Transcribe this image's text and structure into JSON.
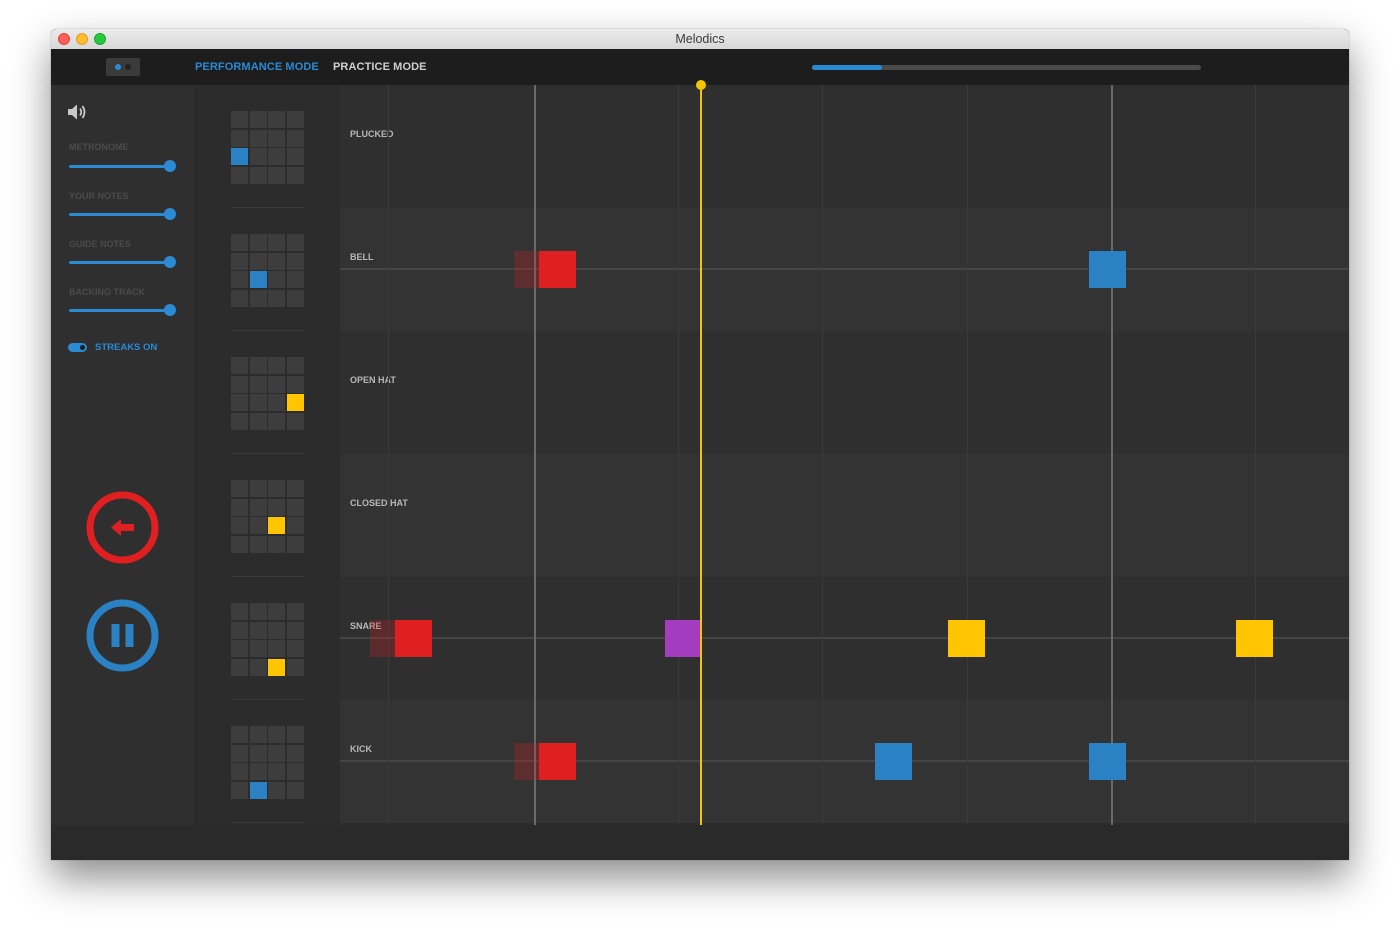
{
  "window": {
    "title": "Melodics"
  },
  "toolbar": {
    "performance_mode_label": "PERFORMANCE MODE",
    "practice_mode_label": "PRACTICE MODE",
    "progress_fraction": 0.18
  },
  "sidebar": {
    "sliders": [
      {
        "label": "METRONOME",
        "value": 1.0
      },
      {
        "label": "YOUR NOTES",
        "value": 1.0
      },
      {
        "label": "GUIDE NOTES",
        "value": 1.0
      },
      {
        "label": "BACKING TRACK",
        "value": 1.0
      }
    ],
    "streaks_label": "STREAKS ON",
    "streaks_on": true,
    "back_button_icon": "arrow-left-icon",
    "pause_button_icon": "pause-icon"
  },
  "colors": {
    "accent_blue": "#2a8ad4",
    "note_red": "#e02020",
    "note_blue": "#2a82c4",
    "note_yellow": "#ffc600",
    "note_purple": "#a33cbf",
    "playhead": "#f5c400"
  },
  "lanes": [
    {
      "label": "PLUCKED",
      "pad": [
        2,
        0
      ],
      "pad_color": "blue",
      "notes": []
    },
    {
      "label": "BELL",
      "pad": [
        2,
        1
      ],
      "pad_color": "blue",
      "notes": [
        {
          "pos": 0.215,
          "color": "red",
          "ghost": true
        },
        {
          "pos": 0.76,
          "color": "blue"
        }
      ]
    },
    {
      "label": "OPEN HAT",
      "pad": [
        2,
        3
      ],
      "pad_color": "yellow",
      "notes": []
    },
    {
      "label": "CLOSED HAT",
      "pad": [
        2,
        2
      ],
      "pad_color": "yellow",
      "notes": []
    },
    {
      "label": "SNARE",
      "pad": [
        3,
        2
      ],
      "pad_color": "yellow",
      "notes": [
        {
          "pos": 0.072,
          "color": "red",
          "ghost": true
        },
        {
          "pos": 0.34,
          "color": "purple"
        },
        {
          "pos": 0.62,
          "color": "yellow"
        },
        {
          "pos": 0.906,
          "color": "yellow"
        }
      ]
    },
    {
      "label": "KICK",
      "pad": [
        3,
        1
      ],
      "pad_color": "blue",
      "notes": [
        {
          "pos": 0.215,
          "color": "red",
          "ghost": true
        },
        {
          "pos": 0.548,
          "color": "blue"
        },
        {
          "pos": 0.76,
          "color": "blue"
        }
      ]
    }
  ],
  "timeline": {
    "playhead_pos": 0.357,
    "bar_lines": [
      0.192,
      0.764
    ],
    "beat_lines": [
      0.048,
      0.335,
      0.478,
      0.621,
      0.907
    ]
  }
}
